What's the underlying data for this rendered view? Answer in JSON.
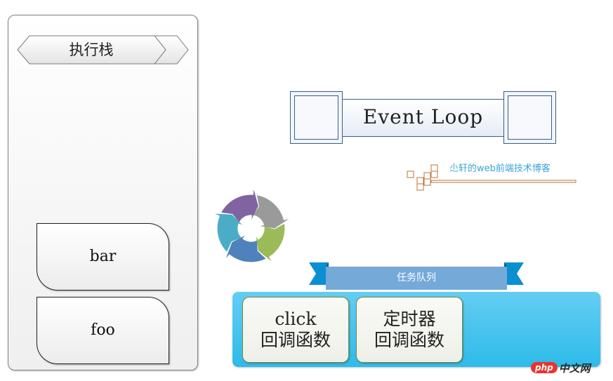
{
  "stack": {
    "title": "执行栈",
    "frames": [
      {
        "label": "bar"
      },
      {
        "label": "foo"
      }
    ]
  },
  "event_loop": {
    "label": "Event Loop"
  },
  "blog": {
    "caption": "尐轩的web前端技术博客"
  },
  "cycle": {
    "icon": "cycle-arrows-icon",
    "colors": [
      "#9a9a9a",
      "#9bbb59",
      "#4f81bd",
      "#4bacc6",
      "#8064a2"
    ]
  },
  "queue": {
    "title": "任务队列",
    "tasks": [
      {
        "line1": "click",
        "line2": "回调函数"
      },
      {
        "line1": "定时器",
        "line2": "回调函数"
      }
    ]
  },
  "colors": {
    "queue_panel": "#3ec3ee",
    "ribbon": "#75a9d8",
    "ribbon_tail": "#0a8fd1",
    "loop_border": "#3a5f8a",
    "blog_text": "#3aa3d8",
    "deco": "#b8753a"
  },
  "watermark": {
    "brand": "php",
    "suffix": "中文网"
  }
}
